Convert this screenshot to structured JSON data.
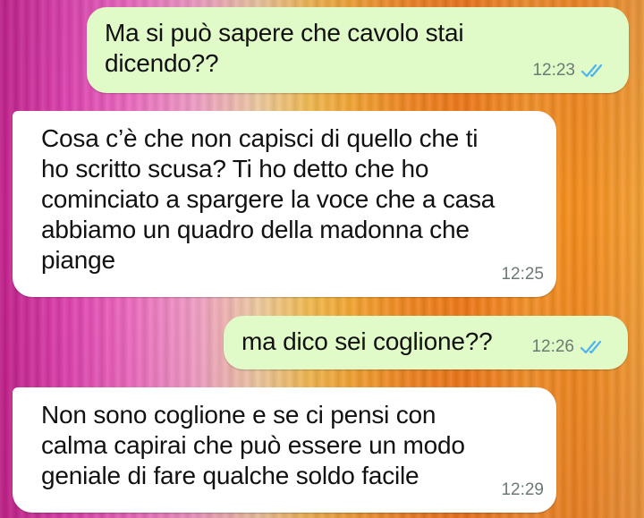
{
  "chat": {
    "messages": [
      {
        "direction": "outgoing",
        "text": "Ma si può sapere che cavolo stai\ndicendo??",
        "time": "12:23",
        "status_icon": "double-check-read-icon"
      },
      {
        "direction": "incoming",
        "text": "Cosa c’è che non capisci di quello che ti\nho scritto scusa? Ti ho detto che ho\ncominciato a spargere la voce che a casa\nabbiamo un quadro della madonna che\npiange",
        "time": "12:25"
      },
      {
        "direction": "outgoing",
        "text": "ma dico sei coglione??",
        "time": "12:26",
        "status_icon": "double-check-read-icon"
      },
      {
        "direction": "incoming",
        "text": "Non sono coglione e se ci pensi con\ncalma capirai che può essere un modo\ngeniale di fare qualche soldo facile",
        "time": "12:29"
      }
    ]
  },
  "colors": {
    "outgoing_bubble": "#e1fbc8",
    "incoming_bubble": "#ffffff",
    "read_ticks": "#4fb3f0",
    "timestamp": "#6b7a73"
  }
}
